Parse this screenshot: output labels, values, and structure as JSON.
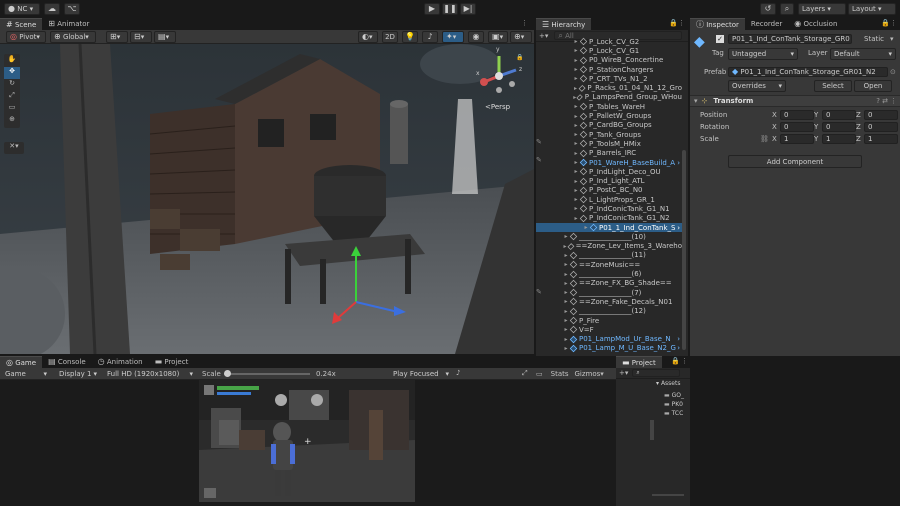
{
  "toolbar": {
    "account": "NC",
    "layers": "Layers",
    "layout": "Layout"
  },
  "scene_tabs": {
    "scene": "Scene",
    "animator": "Animator"
  },
  "scene_toolbar": {
    "pivot": "Pivot",
    "global": "Global",
    "mode_2d": "2D"
  },
  "scene_view": {
    "persp_label": "<Persp",
    "gizmo_axis_y": "y",
    "gizmo_axis_z": "z",
    "gizmo_axis_x": "x"
  },
  "hierarchy": {
    "tab": "Hierarchy",
    "search_placeholder": "All",
    "items": [
      {
        "label": "P_Lock_CV_G2",
        "type": "obj"
      },
      {
        "label": "P_Lock_CV_G1",
        "type": "obj"
      },
      {
        "label": "P0_WireB_Concertine",
        "type": "obj"
      },
      {
        "label": "P_StationChargers",
        "type": "obj"
      },
      {
        "label": "P_CRT_TVs_N1_2",
        "type": "obj"
      },
      {
        "label": "P_Racks_01_04_N1_12_Gro",
        "type": "obj"
      },
      {
        "label": "P_LampsPend_Group_WHou",
        "type": "obj"
      },
      {
        "label": "P_Tables_WareH",
        "type": "obj"
      },
      {
        "label": "P_PalletW_Groups",
        "type": "obj"
      },
      {
        "label": "P_CardBG_Groups",
        "type": "obj"
      },
      {
        "label": "P_Tank_Groups",
        "type": "obj"
      },
      {
        "label": "P_ToolsM_HMix",
        "type": "obj"
      },
      {
        "label": "P_Barrels_IRC",
        "type": "obj"
      },
      {
        "label": "P01_WareH_BaseBuild_A",
        "type": "prefab"
      },
      {
        "label": "P_IndLight_Deco_OU",
        "type": "obj"
      },
      {
        "label": "P_Ind_Light_ATL",
        "type": "obj"
      },
      {
        "label": "P_PostC_BC_N0",
        "type": "obj"
      },
      {
        "label": "L_LightProps_GR_1",
        "type": "obj"
      },
      {
        "label": "P_IndConicTank_G1_N1",
        "type": "obj"
      },
      {
        "label": "P_IndConicTank_G1_N2",
        "type": "obj"
      },
      {
        "label": "P01_1_Ind_ConTank_S",
        "type": "selected"
      },
      {
        "label": "_______________(10)",
        "type": "obj"
      },
      {
        "label": "==Zone_Lev_Items_3_Wareho",
        "type": "obj"
      },
      {
        "label": "_______________(11)",
        "type": "obj"
      },
      {
        "label": "==ZoneMusic==",
        "type": "obj"
      },
      {
        "label": "_______________(6)",
        "type": "obj"
      },
      {
        "label": "==Zone_FX_BG_Shade==",
        "type": "obj"
      },
      {
        "label": "_______________(7)",
        "type": "obj"
      },
      {
        "label": "==Zone_Fake_Decals_N01",
        "type": "obj"
      },
      {
        "label": "_______________(12)",
        "type": "obj"
      },
      {
        "label": "P_Fire",
        "type": "obj"
      },
      {
        "label": "V=F",
        "type": "obj"
      },
      {
        "label": "P01_LampMod_Ur_Base_N",
        "type": "prefab"
      },
      {
        "label": "P01_Lamp_M_U_Base_N2_G",
        "type": "prefab"
      }
    ]
  },
  "inspector": {
    "tabs": [
      "Inspector",
      "Recorder",
      "Occlusion"
    ],
    "object_name": "P01_1_Ind_ConTank_Storage_GR0",
    "static_label": "Static",
    "tag_label": "Tag",
    "tag_value": "Untagged",
    "layer_label": "Layer",
    "layer_value": "Default",
    "prefab_label": "Prefab",
    "prefab_value": "P01_1_Ind_ConTank_Storage_GR01_N2",
    "overrides": "Overrides",
    "select": "Select",
    "open": "Open",
    "transform_title": "Transform",
    "position_label": "Position",
    "rotation_label": "Rotation",
    "scale_label": "Scale",
    "position": {
      "x": "0",
      "y": "0",
      "z": "0"
    },
    "rotation": {
      "x": "0",
      "y": "0",
      "z": "0"
    },
    "scale": {
      "x": "1",
      "y": "1",
      "z": "1"
    },
    "add_component": "Add Component"
  },
  "bottom_tabs": {
    "game": "Game",
    "console": "Console",
    "animation": "Animation",
    "project": "Project"
  },
  "game_toolbar": {
    "game": "Game",
    "display": "Display 1",
    "resolution": "Full HD (1920x1080)",
    "scale_label": "Scale",
    "scale_value": "0.24x",
    "play_focused": "Play Focused",
    "stats": "Stats",
    "gizmos": "Gizmos"
  },
  "project": {
    "tab": "Project",
    "assets_label": "Assets",
    "folders": [
      "GO_",
      "PK0",
      "TCC"
    ]
  },
  "colors": {
    "accent": "#2c5d87",
    "prefab": "#6fb8ff"
  }
}
